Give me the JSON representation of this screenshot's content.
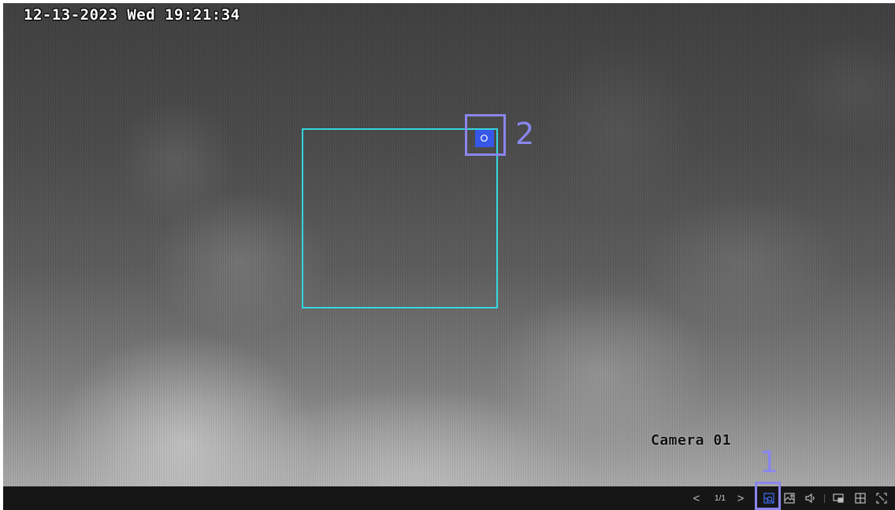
{
  "osd": {
    "timestamp": "12-13-2023 Wed 19:21:34",
    "camera_name": "Camera 01"
  },
  "callouts": {
    "label_1": "1",
    "label_2": "2"
  },
  "toolbar": {
    "prev_label": "<",
    "page_indicator": "1/1",
    "next_label": ">",
    "icons": {
      "zoom": "digital-zoom-icon",
      "snapshot": "snapshot-icon",
      "audio": "speaker-icon",
      "window": "window-icon",
      "layout": "grid-layout-icon",
      "fullscreen": "fullscreen-icon"
    }
  },
  "colors": {
    "zoom_region_border": "#36d6e0",
    "zoom_handle": "#3657e8",
    "callout": "#8a86ee",
    "toolbar_bg": "#161616",
    "active_icon": "#3f6cf2"
  }
}
